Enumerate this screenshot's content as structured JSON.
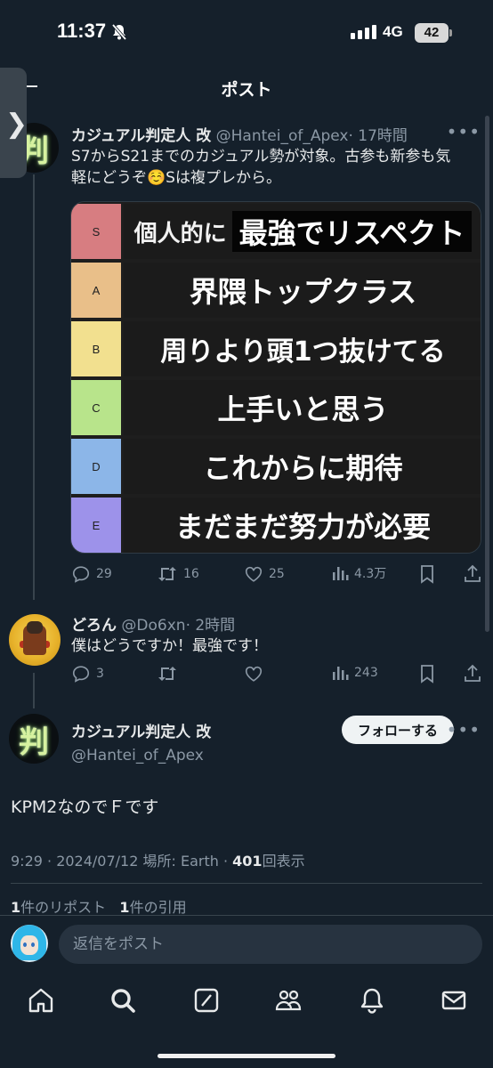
{
  "status_bar": {
    "time": "11:37",
    "network": "4G",
    "battery": "42"
  },
  "header": {
    "title": "ポスト"
  },
  "tweet1": {
    "name": "カジュアル判定人 改",
    "handle": "@Hantei_of_Apex",
    "time": "· 17時間",
    "avatar_kanji": "判",
    "text_line1": "S7からS21までのカジュアル勢が対象。古参も新参も気",
    "text_line2": "軽にどうぞ☺️Sは複プレから。",
    "tiers": [
      {
        "letter": "S",
        "color": "#d77d81",
        "prefix": "個人的に",
        "label": "最強でリスペクト"
      },
      {
        "letter": "A",
        "color": "#e9bf89",
        "prefix": "",
        "label": "界隈トップクラス"
      },
      {
        "letter": "B",
        "color": "#f2e08f",
        "prefix": "",
        "label": "周りより頭1つ抜けてる"
      },
      {
        "letter": "C",
        "color": "#b8e48b",
        "prefix": "",
        "label": "上手いと思う"
      },
      {
        "letter": "D",
        "color": "#8cb6e8",
        "prefix": "",
        "label": "これからに期待"
      },
      {
        "letter": "E",
        "color": "#9d92ea",
        "prefix": "",
        "label": "まだまだ努力が必要"
      }
    ],
    "replies": "29",
    "retweets": "16",
    "likes": "25",
    "views": "4.3万"
  },
  "tweet2": {
    "name": "どろん",
    "handle": "@Do6xn",
    "time": "· 2時間",
    "text": "僕はどうですか！最強です！",
    "replies": "3",
    "retweets": "",
    "likes": "",
    "views": "243"
  },
  "main_post": {
    "name": "カジュアル判定人 改",
    "handle": "@Hantei_of_Apex",
    "avatar_kanji": "判",
    "follow_label": "フォローする",
    "text": "KPM2なのでＦです",
    "meta_time": "9:29 · 2024/07/12 場所: Earth ·",
    "views_count": "401",
    "views_label": "回表示",
    "reposts_count": "1",
    "reposts_label": "件のリポスト",
    "quotes_count": "1",
    "quotes_label": "件の引用"
  },
  "reply_bar": {
    "placeholder": "返信をポスト"
  },
  "tab_bar": {
    "icons": [
      "home-icon",
      "search-icon",
      "grok-icon",
      "communities-icon",
      "notifications-icon",
      "messages-icon"
    ]
  }
}
